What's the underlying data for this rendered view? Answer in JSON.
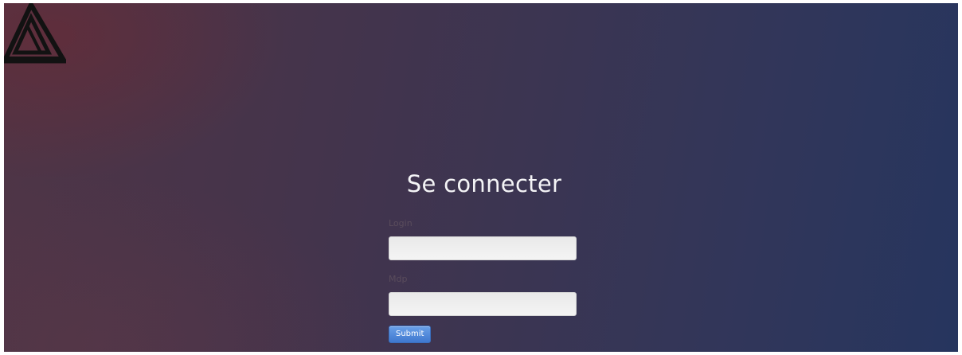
{
  "logo": {
    "icon": "triangle-logo-icon"
  },
  "login": {
    "title": "Se connecter",
    "login_label": "Login",
    "login_value": "",
    "password_label": "Mdp",
    "password_value": "",
    "submit_label": "Submit"
  },
  "colors": {
    "background_left": "#4f3546",
    "background_right": "#26355e",
    "button": "#3f78cf"
  }
}
